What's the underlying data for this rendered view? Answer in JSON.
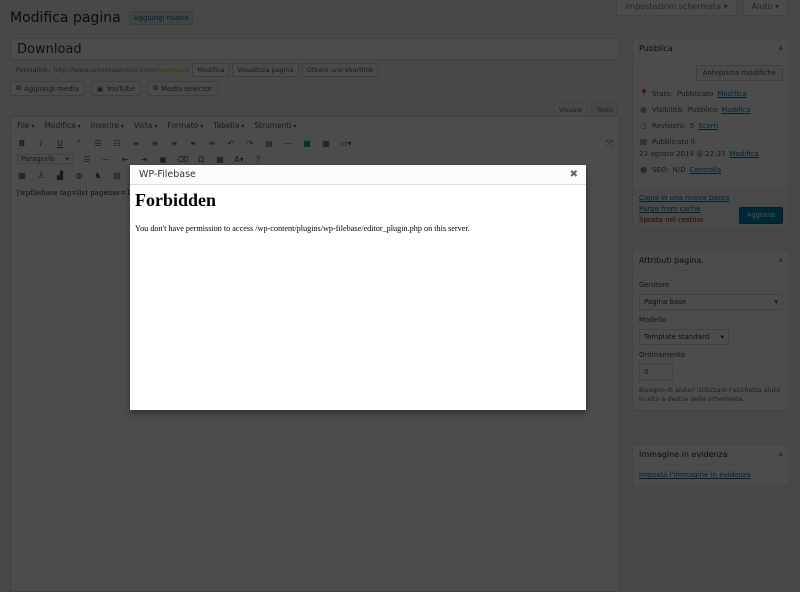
{
  "screen_options": {
    "screen_label": "Impostazioni schermata",
    "help_label": "Aiuto"
  },
  "header": {
    "title": "Modifica pagina",
    "add_new": "Aggiungi nuova"
  },
  "post": {
    "title": "Download",
    "permalink_label": "Permalink:",
    "permalink_base": "http://www.universaececo.com/",
    "permalink_slug": "download",
    "permalink_end": "/",
    "permalink_buttons": [
      "Modifica",
      "Visualizza pagina",
      "Ottieni uno shortlink"
    ]
  },
  "media_buttons": [
    {
      "label": "Aggiungi media",
      "icon": "media-icon"
    },
    {
      "label": "YouTube",
      "icon": "youtube-icon"
    },
    {
      "label": "Media selector",
      "icon": "media-selector-icon"
    }
  ],
  "editor": {
    "tabs": [
      "Visuale",
      "Testo"
    ],
    "menu": [
      "File",
      "Modifica",
      "Inserire",
      "Vista",
      "Formato",
      "Tabella",
      "Strumenti"
    ],
    "format_select": "Paragrafo",
    "content": "[wpfilebase tag=list pagenav=1 /]"
  },
  "publish_box": {
    "title": "Pubblica",
    "preview_button": "Anteprima modifiche",
    "status_label": "Stato:",
    "status_value": "Pubblicato",
    "visibility_label": "Visibilità:",
    "visibility_value": "Pubblico",
    "revisions_label": "Revisioni:",
    "revisions_count": "5",
    "revisions_link": "Scorri",
    "published_label": "Pubblicato il:",
    "published_value": "23 agosto 2014 @ 22:33",
    "seo_label": "SEO:",
    "seo_value": "N/D",
    "seo_link": "Controlla",
    "edit_link": "Modifica",
    "copy_link": "Copia in una nuova bozza",
    "purge_link": "Purge from cache",
    "trash_link": "Sposta nel cestino",
    "update_button": "Aggiorna"
  },
  "attributes_box": {
    "title": "Attributi pagina.",
    "parent_label": "Genitore",
    "parent_value": "Pagina base",
    "template_label": "Modello",
    "template_value": "Template standard",
    "order_label": "Ordinamento",
    "order_value": "0",
    "help": "Bisogno di aiuto? Utilizzare l'etichetta aiuto in alto a destra della schermata."
  },
  "featured_box": {
    "title": "Immagine in evidenza",
    "set_link": "Imposta l'immagine in evidenza"
  },
  "modal": {
    "title": "WP-Filebase",
    "heading": "Forbidden",
    "message": "You don't have permission to access /wp-content/plugins/wp-filebase/editor_plugin.php on this server."
  }
}
